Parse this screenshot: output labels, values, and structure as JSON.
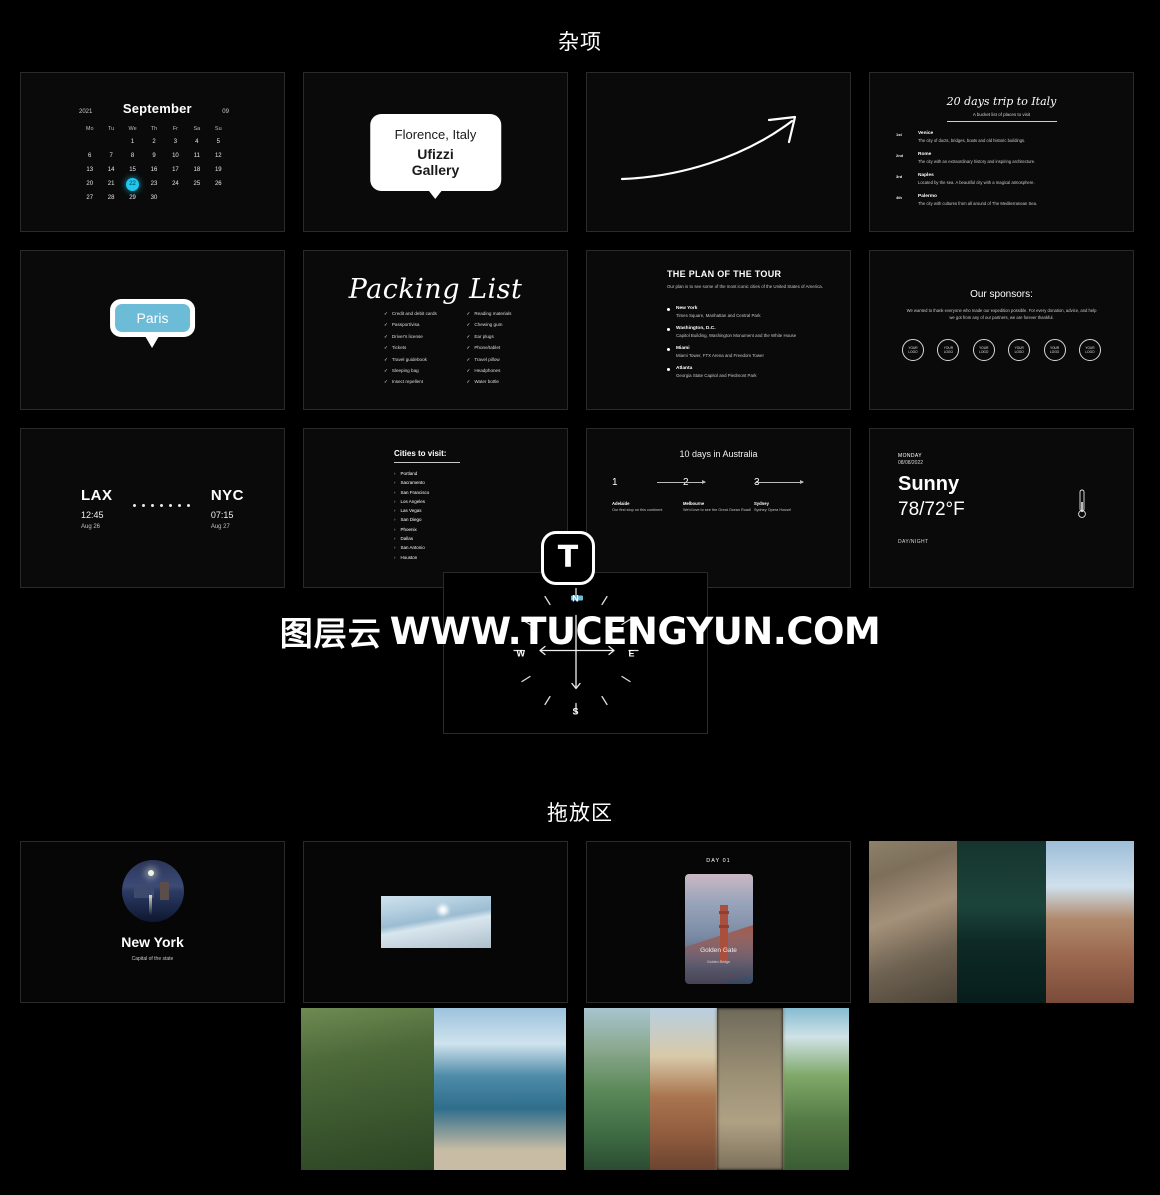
{
  "sections": {
    "misc_title": "杂项",
    "dropzone_title": "拖放区"
  },
  "watermark": {
    "logo_letter": "T",
    "cn_text": "图层云",
    "url_text": "WWW.TUCENGYUN.COM"
  },
  "calendar": {
    "year": "2021",
    "month": "September",
    "week_number": "09",
    "dow": [
      "Mo",
      "Tu",
      "We",
      "Th",
      "Fr",
      "Sa",
      "Su"
    ],
    "days": [
      "",
      "",
      "1",
      "2",
      "3",
      "4",
      "5",
      "6",
      "7",
      "8",
      "9",
      "10",
      "11",
      "12",
      "13",
      "14",
      "15",
      "16",
      "17",
      "18",
      "19",
      "20",
      "21",
      "22",
      "23",
      "24",
      "25",
      "26",
      "27",
      "28",
      "29",
      "30"
    ],
    "selected_day": "22",
    "accent_color": "#1ec8ef"
  },
  "tooltip_white": {
    "line1": "Florence, Italy",
    "line2": "Ufizzi Gallery"
  },
  "arrow_card": {
    "label": "curved-arrow"
  },
  "italy": {
    "title": "20 days trip to Italy",
    "subtitle": "A bucket list of places to visit",
    "rows": [
      {
        "ord": "1st",
        "city": "Venice",
        "desc": "The city of ducts, bridges, boats and old historic buildings."
      },
      {
        "ord": "2nd",
        "city": "Rome",
        "desc": "The city with an extraordinary history and inspiring architecture."
      },
      {
        "ord": "3rd",
        "city": "Naples",
        "desc": "Located by the sea. A beautiful city with a magical atmosphere."
      },
      {
        "ord": "4th",
        "city": "Palermo",
        "desc": "The city with cultures from all around of The Mediterranean Sea."
      }
    ]
  },
  "paris_chip": {
    "label": "Paris",
    "fill_color": "#6cbcd8"
  },
  "packing": {
    "title": "Packing List",
    "check": "✓",
    "col1": [
      "Credit and debit cards",
      "Passport/visa",
      "Driver's license",
      "Tickets",
      "Travel guidebook",
      "Sleeping bag",
      "Insect repellent"
    ],
    "col2": [
      "Reading materials",
      "Chewing gum",
      "Ear plugs",
      "Phone/tablet",
      "Travel pillow",
      "Headphones",
      "Water bottle"
    ]
  },
  "plan": {
    "title": "THE PLAN OF THE TOUR",
    "subtitle": "Our plan is to see some of the most iconic cities of the United States of America.",
    "rows": [
      {
        "city": "New York",
        "desc": "Times Square, Manhattan and Central Park"
      },
      {
        "city": "Washington, D.C.",
        "desc": "Capitol Building, Washington Monument and the White House"
      },
      {
        "city": "Miami",
        "desc": "Miami Tower, FTX Arena and Freedom Tower"
      },
      {
        "city": "Atlanta",
        "desc": "Georgia State Capitol and Piedmont Park"
      }
    ]
  },
  "sponsors": {
    "title": "Our sponsors:",
    "subtitle": "We wanted to thank everyone who made our expedition possible. For every donation, advice, and help we got from any of our partners, we are forever thankful.",
    "logos": [
      "YOUR LOGO",
      "YOUR LOGO",
      "YOUR LOGO",
      "YOUR LOGO",
      "YOUR LOGO",
      "YOUR LOGO"
    ]
  },
  "flight": {
    "from_code": "LAX",
    "from_time": "12:45",
    "from_date": "Aug 26",
    "to_code": "NYC",
    "to_time": "07:15",
    "to_date": "Aug 27",
    "dot_count": 7
  },
  "cities": {
    "title": "Cities to visit:",
    "items": [
      "Portland",
      "Sacramento",
      "San Francisco",
      "Los Angeles",
      "Las Vegas",
      "San Diego",
      "Phoenix",
      "Dallas",
      "San Antonio",
      "Houston"
    ]
  },
  "australia": {
    "title": "10 days in Australia",
    "steps": [
      {
        "n": "1",
        "city": "Adelaide",
        "desc": "Our first stop on this continent"
      },
      {
        "n": "2",
        "city": "Melbourne",
        "desc": "We'd love to see the Great Ocean Road!"
      },
      {
        "n": "3",
        "city": "Sydney",
        "desc": "Sydney Opera House!"
      }
    ]
  },
  "weather": {
    "day": "MONDAY",
    "date": "08/08/2022",
    "condition": "Sunny",
    "temperature": "78/72°F",
    "footer": "DAY/NIGHT",
    "icon": "thermometer-icon"
  },
  "compass": {
    "north": "N",
    "east": "E",
    "south": "S",
    "west": "W",
    "needle_color": "#6cbcd8"
  },
  "dropzone": {
    "new_york": {
      "title": "New York",
      "subtitle": "Capital of the state",
      "image": "new-york-night-skyline"
    },
    "ice": {
      "image": "icy-landscape-thumbnail"
    },
    "golden_gate": {
      "day_label": "DAY 01",
      "title": "Golden Gate",
      "subtitle": "Golden Bridge",
      "image": "golden-gate-bridge-fog"
    },
    "strip_a": [
      "winding-road-landscape",
      "dark-lake-night",
      "canyon-cliffs"
    ],
    "strip_b": [
      "palm-trees-lawn",
      "tropical-beach-bay"
    ],
    "strip_c": [
      "red-rock-mesa",
      "blurred-scene",
      "green-valley-river",
      "grass-hills-sea"
    ]
  }
}
